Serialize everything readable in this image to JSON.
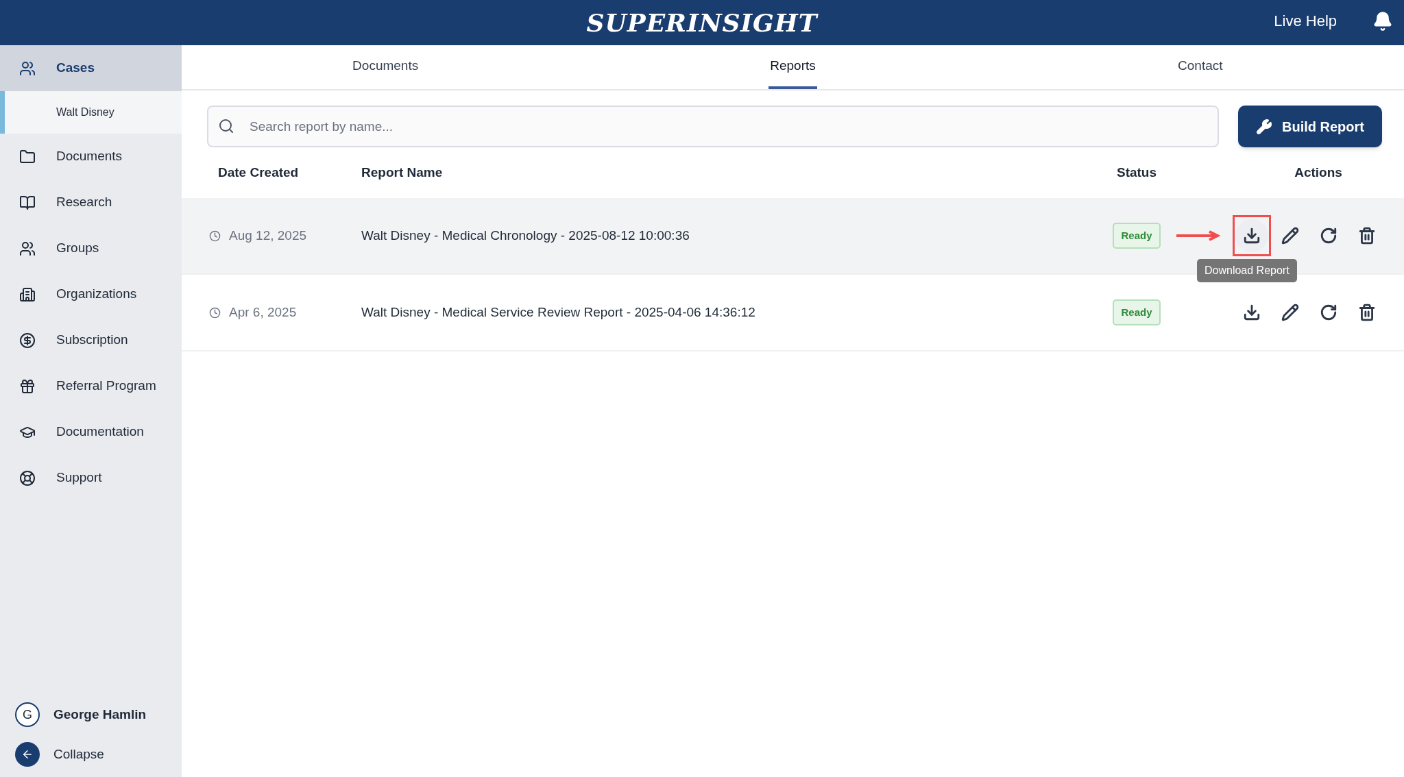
{
  "header": {
    "logo": "SUPERINSIGHT",
    "live_help": "Live Help"
  },
  "sidebar": {
    "items": [
      {
        "kind": "cases",
        "label": "Cases",
        "selected": true,
        "children": [
          {
            "label": "Walt Disney",
            "selected": true
          }
        ]
      },
      {
        "kind": "folder",
        "label": "Documents",
        "selected": false
      },
      {
        "kind": "book",
        "label": "Research",
        "selected": false
      },
      {
        "kind": "people",
        "label": "Groups",
        "selected": false
      },
      {
        "kind": "building",
        "label": "Organizations",
        "selected": false
      },
      {
        "kind": "dollar",
        "label": "Subscription",
        "selected": false
      },
      {
        "kind": "gift",
        "label": "Referral Program",
        "selected": false
      },
      {
        "kind": "school",
        "label": "Documentation",
        "selected": false
      },
      {
        "kind": "lifebuoy",
        "label": "Support",
        "selected": false
      }
    ],
    "user": {
      "initial": "G",
      "name": "George Hamlin"
    },
    "collapse": "Collapse"
  },
  "tabs": [
    {
      "label": "Documents",
      "selected": false
    },
    {
      "label": "Reports",
      "selected": true
    },
    {
      "label": "Contact",
      "selected": false
    }
  ],
  "search": {
    "placeholder": "Search report by name..."
  },
  "build_button": "Build Report",
  "table": {
    "columns": [
      "Date Created",
      "Report Name",
      "Status",
      "Actions"
    ],
    "rows": [
      {
        "date": "Aug 12, 2025",
        "name": "Walt Disney - Medical Chronology - 2025-08-12 10:00:36",
        "status": "Ready",
        "hovered": true,
        "actions": [
          {
            "kind": "download",
            "annotated": true,
            "tooltip": "Download Report"
          },
          {
            "kind": "edit",
            "annotated": false
          },
          {
            "kind": "regenerate",
            "annotated": false
          },
          {
            "kind": "delete",
            "annotated": false
          }
        ]
      },
      {
        "date": "Apr 6, 2025",
        "name": "Walt Disney - Medical Service Review Report - 2025-04-06 14:36:12",
        "status": "Ready",
        "hovered": false,
        "actions": [
          {
            "kind": "download",
            "annotated": false
          },
          {
            "kind": "edit",
            "annotated": false
          },
          {
            "kind": "regenerate",
            "annotated": false
          },
          {
            "kind": "delete",
            "annotated": false
          }
        ]
      }
    ]
  }
}
